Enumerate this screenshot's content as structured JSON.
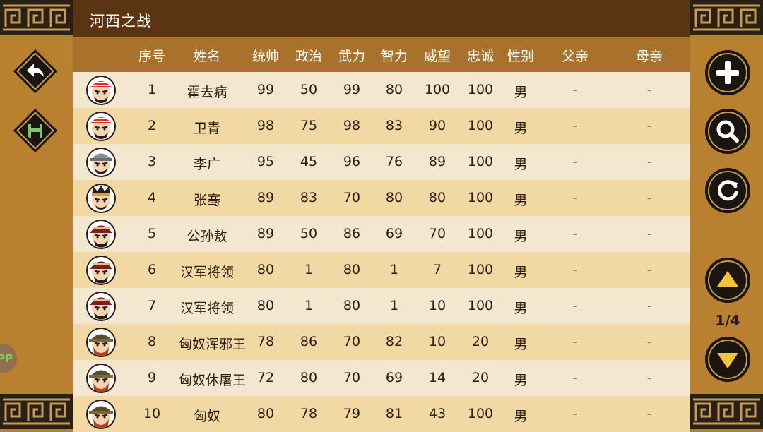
{
  "title": "河西之战",
  "columns": [
    "序号",
    "姓名",
    "统帅",
    "政治",
    "武力",
    "智力",
    "威望",
    "忠诚",
    "性别",
    "父亲",
    "母亲"
  ],
  "rows": [
    {
      "avatar": "red-turban-face",
      "no": "1",
      "name": "霍去病",
      "tongshuai": "99",
      "zhengzhi": "50",
      "wuli": "99",
      "zhili": "80",
      "weiwang": "100",
      "zhongcheng": "100",
      "xingbie": "男",
      "father": "-",
      "mother": "-"
    },
    {
      "avatar": "red-turban-face",
      "no": "2",
      "name": "卫青",
      "tongshuai": "98",
      "zhengzhi": "75",
      "wuli": "98",
      "zhili": "83",
      "weiwang": "90",
      "zhongcheng": "100",
      "xingbie": "男",
      "father": "-",
      "mother": "-"
    },
    {
      "avatar": "gray-helmet-face",
      "no": "3",
      "name": "李广",
      "tongshuai": "95",
      "zhengzhi": "45",
      "wuli": "96",
      "zhili": "76",
      "weiwang": "89",
      "zhongcheng": "100",
      "xingbie": "男",
      "father": "-",
      "mother": "-"
    },
    {
      "avatar": "crown-face",
      "no": "4",
      "name": "张骞",
      "tongshuai": "89",
      "zhengzhi": "83",
      "wuli": "70",
      "zhili": "80",
      "weiwang": "80",
      "zhongcheng": "100",
      "xingbie": "男",
      "father": "-",
      "mother": "-"
    },
    {
      "avatar": "maroon-helmet-face",
      "no": "5",
      "name": "公孙敖",
      "tongshuai": "89",
      "zhengzhi": "50",
      "wuli": "86",
      "zhili": "69",
      "weiwang": "70",
      "zhongcheng": "100",
      "xingbie": "男",
      "father": "-",
      "mother": "-"
    },
    {
      "avatar": "maroon-helmet-face",
      "no": "6",
      "name": "汉军将领",
      "tongshuai": "80",
      "zhengzhi": "1",
      "wuli": "80",
      "zhili": "1",
      "weiwang": "7",
      "zhongcheng": "100",
      "xingbie": "男",
      "father": "-",
      "mother": "-"
    },
    {
      "avatar": "maroon-helmet-face",
      "no": "7",
      "name": "汉军将领",
      "tongshuai": "80",
      "zhengzhi": "1",
      "wuli": "80",
      "zhili": "1",
      "weiwang": "10",
      "zhongcheng": "100",
      "xingbie": "男",
      "father": "-",
      "mother": "-"
    },
    {
      "avatar": "xiongnu-face",
      "no": "8",
      "name": "匈奴浑邪王",
      "tongshuai": "78",
      "zhengzhi": "86",
      "wuli": "70",
      "zhili": "82",
      "weiwang": "10",
      "zhongcheng": "20",
      "xingbie": "男",
      "father": "-",
      "mother": "-"
    },
    {
      "avatar": "xiongnu-face",
      "no": "9",
      "name": "匈奴休屠王",
      "tongshuai": "72",
      "zhengzhi": "80",
      "wuli": "70",
      "zhili": "69",
      "weiwang": "14",
      "zhongcheng": "20",
      "xingbie": "男",
      "father": "-",
      "mother": "-"
    },
    {
      "avatar": "xiongnu-face",
      "no": "10",
      "name": "匈奴",
      "tongshuai": "80",
      "zhengzhi": "78",
      "wuli": "79",
      "zhili": "81",
      "weiwang": "43",
      "zhongcheng": "100",
      "xingbie": "男",
      "father": "-",
      "mother": "-"
    }
  ],
  "left_buttons": [
    {
      "name": "back-button",
      "icon": "back-arrow-icon"
    },
    {
      "name": "save-button",
      "icon": "save-floppy-icon"
    }
  ],
  "right_buttons": [
    {
      "name": "add-button",
      "icon": "plus-icon"
    },
    {
      "name": "search-button",
      "icon": "search-icon"
    },
    {
      "name": "refresh-button",
      "icon": "refresh-icon"
    },
    {
      "name": "page-up-button",
      "icon": "triangle-up-icon"
    },
    {
      "name": "page-down-button",
      "icon": "triangle-down-icon"
    }
  ],
  "pagination": {
    "text": "1/4",
    "current": 1,
    "total": 4
  },
  "app_bubble": {
    "label": "PP"
  },
  "colors": {
    "titlebar": "#5a3413",
    "header": "#a8722c",
    "row_odd": "#f3e7cf",
    "row_even": "#f2d9a4",
    "side": "#b9802f",
    "button_black": "#1a1510",
    "save_green": "#7fc36a"
  }
}
